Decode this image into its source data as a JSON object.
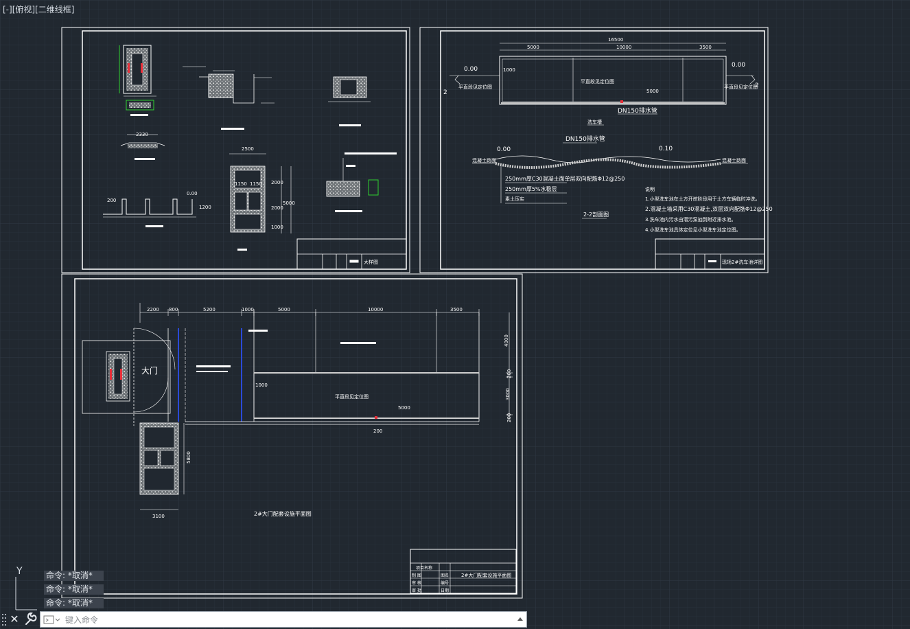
{
  "viewport": {
    "label": "[-][俯视][二维线框]"
  },
  "drawings": {
    "top_left_sheet": {
      "dims": [
        "2330",
        "2500",
        "1150",
        "1150",
        "2000",
        "2000",
        "1000",
        "5000",
        "0.00",
        "200",
        "1200"
      ],
      "title_text": "大样图"
    },
    "top_right_sheet": {
      "dims_top": [
        "16500",
        "5000",
        "10000",
        "3500"
      ],
      "level_left": "0.00",
      "level_right": "0.00",
      "locate_left": "平直段见定位图",
      "locate_center": "平直段见定位图",
      "locate_right": "平直段见定位图",
      "dim_inner_1000": "1000",
      "dim_inner_5000": "5000",
      "pipe_label": "DN150排水管",
      "plan_title": "洗车槽",
      "section_pipe_label": "DN150排水管",
      "section_level_left": "0.00",
      "section_level_right": "0.10",
      "road_left": "混凝土路面",
      "road_right": "混凝土路面",
      "layer1": "250mm厚C30混凝土面单层双向配筋Φ12@250",
      "layer2": "250mm厚5%水稳层",
      "layer3": "素土压实",
      "section_title": "2-2剖面图",
      "notes_title": "说明",
      "notes": [
        "1.小型洗车池在土方开挖阶段用于土方车辆临时冲洗。",
        "2.混凝土墙采用C30混凝土,双层双向配筋Φ12@250",
        "3.洗车池内污水由潜污泵抽到附近排水池。",
        "4.小型洗车池具体定位见小型洗车池定位图。"
      ],
      "title_text": "现场2#洗车池详图",
      "section_mark": "2"
    },
    "bottom_sheet": {
      "dims_top": [
        "2200",
        "800",
        "5200",
        "1000",
        "5000",
        "10000",
        "3500"
      ],
      "gate_label": "大门",
      "locate_center": "平直段见定位图",
      "dim_right": [
        "4000",
        "200",
        "3000",
        "200"
      ],
      "dim_inner_1000": "1000",
      "dim_inner_5000": "5000",
      "dim_bottom": "3100",
      "dim_vertical": "5800",
      "dim_bottom_200": "200",
      "plan_title": "2#大门配套设施平面图",
      "title_block": {
        "project_label": "项目名称",
        "row_labels": [
          "制 图",
          "审 核",
          "审 批"
        ],
        "drawing_name_label": "图名",
        "drawing_name": "2#大门配套设施平面图",
        "number_label": "编号",
        "date_label": "日期"
      }
    }
  },
  "command_line": {
    "history": [
      "命令: *取消*",
      "命令: *取消*",
      "命令: *取消*"
    ],
    "placeholder": "键入命令",
    "close_icon": "close-icon",
    "wrench_icon": "wrench-icon"
  },
  "ucs": {
    "y_label": "Y"
  },
  "colors": {
    "background": "#212830",
    "grid_minor": "#262e37",
    "grid_major": "#2d3640",
    "linework": "#ffffff",
    "hatch": "#c8c8c8",
    "accent_red": "#e8303a",
    "accent_green": "#30d030",
    "accent_blue": "#2a4ad8"
  }
}
